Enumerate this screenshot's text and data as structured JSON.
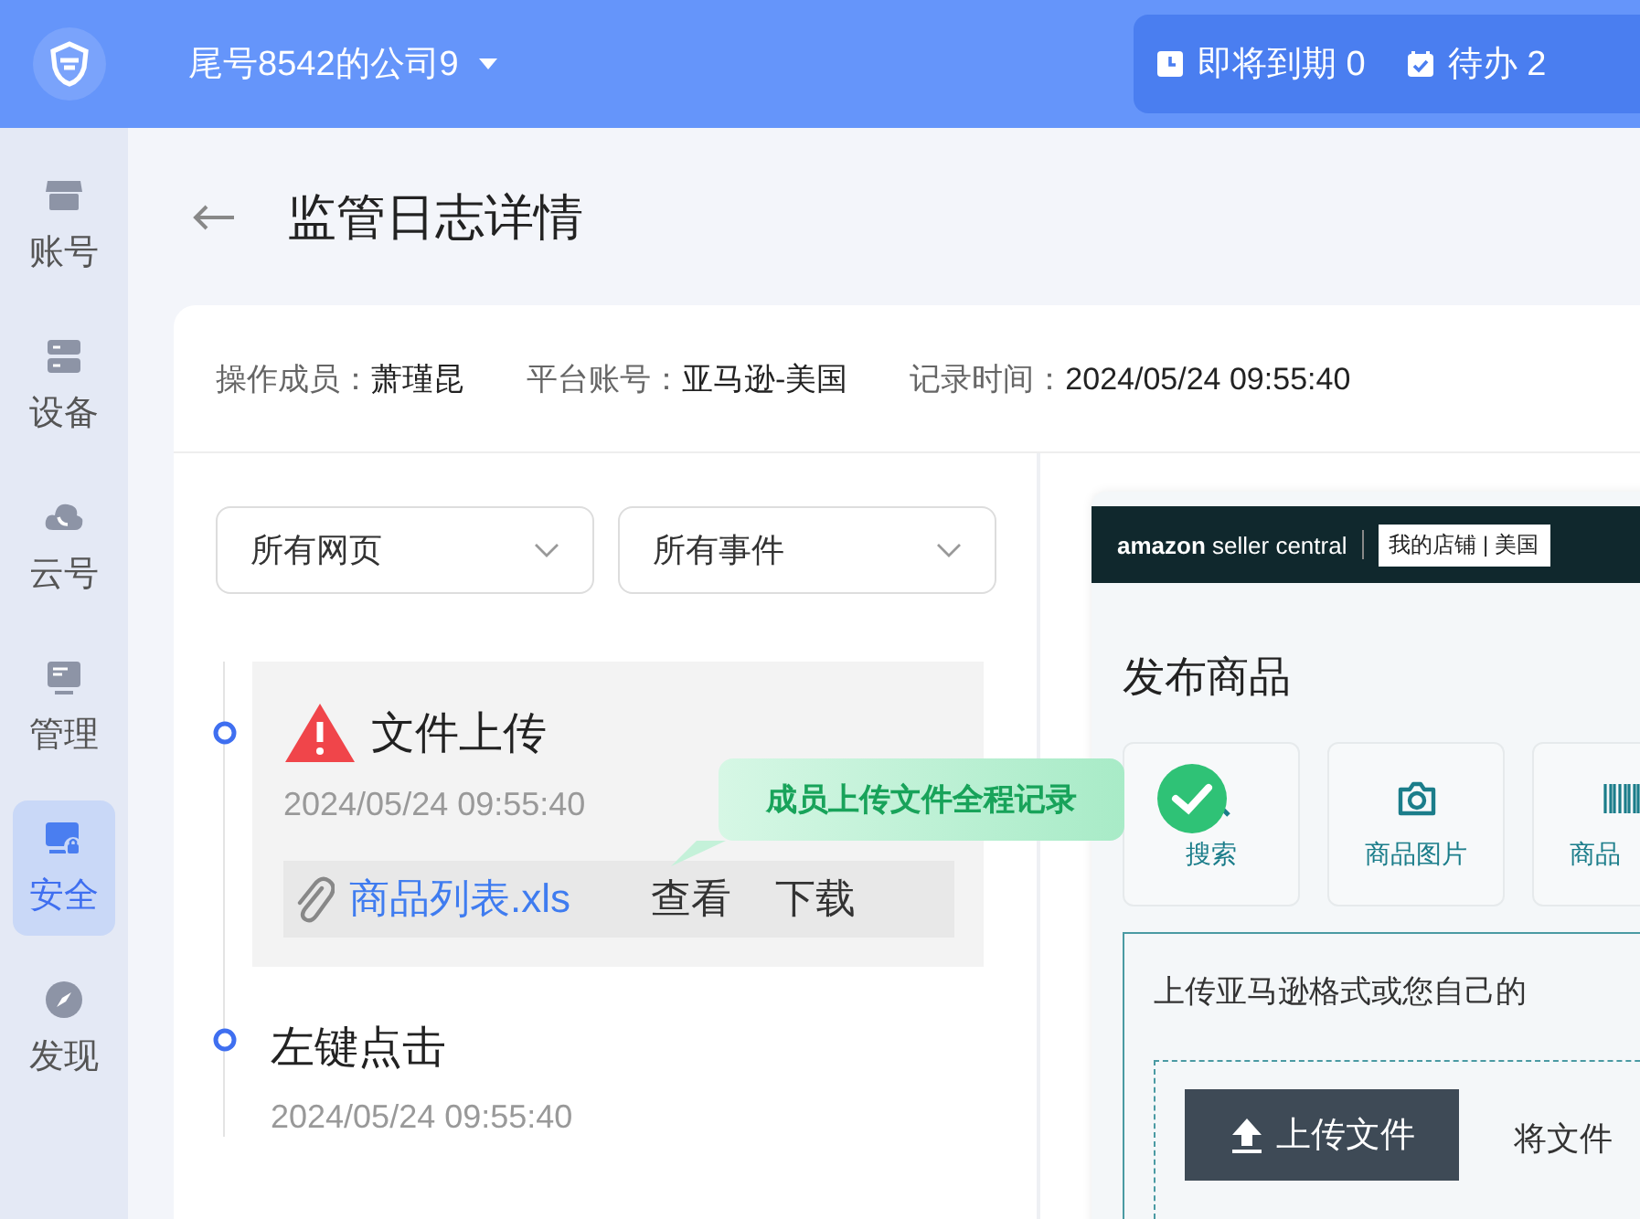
{
  "topbar": {
    "company": "尾号8542的公司9",
    "badges": [
      {
        "kind": "clock",
        "label": "即将到期",
        "count": "0"
      },
      {
        "kind": "todo",
        "label": "待办",
        "count": "2"
      }
    ]
  },
  "sidebar": {
    "items": [
      {
        "kind": "store",
        "label": "账号",
        "selected": false
      },
      {
        "kind": "server",
        "label": "设备",
        "selected": false
      },
      {
        "kind": "cloud",
        "label": "云号",
        "selected": false
      },
      {
        "kind": "monitor",
        "label": "管理",
        "selected": false
      },
      {
        "kind": "security",
        "label": "安全",
        "selected": true
      },
      {
        "kind": "compass",
        "label": "发现",
        "selected": false
      }
    ]
  },
  "page": {
    "title": "监管日志详情"
  },
  "info": [
    {
      "label": "操作成员：",
      "value": "萧瑾昆"
    },
    {
      "label": "平台账号：",
      "value": "亚马逊-美国"
    },
    {
      "label": "记录时间：",
      "value": "2024/05/24 09:55:40"
    }
  ],
  "filters": [
    {
      "value": "所有网页"
    },
    {
      "value": "所有事件"
    }
  ],
  "events": [
    {
      "warning": true,
      "title": "文件上传",
      "time": "2024/05/24 09:55:40",
      "attachment": {
        "file": "商品列表.xls",
        "actions": [
          "查看",
          "下载"
        ]
      }
    },
    {
      "warning": false,
      "title": "左键点击",
      "time": "2024/05/24 09:55:40"
    }
  ],
  "tooltip": {
    "text": "成员上传文件全程记录"
  },
  "preview": {
    "brand": "amazon",
    "product": "seller central",
    "store": "我的店铺 | 美国",
    "heading": "发布商品",
    "tiles": [
      {
        "kind": "search",
        "label": "搜索"
      },
      {
        "kind": "camera",
        "label": "商品图片"
      },
      {
        "kind": "barcode",
        "label": "商品"
      }
    ],
    "upload_hint": "上传亚马逊格式或您自己的",
    "upload_button": "上传文件",
    "drop_hint": "将文件"
  }
}
